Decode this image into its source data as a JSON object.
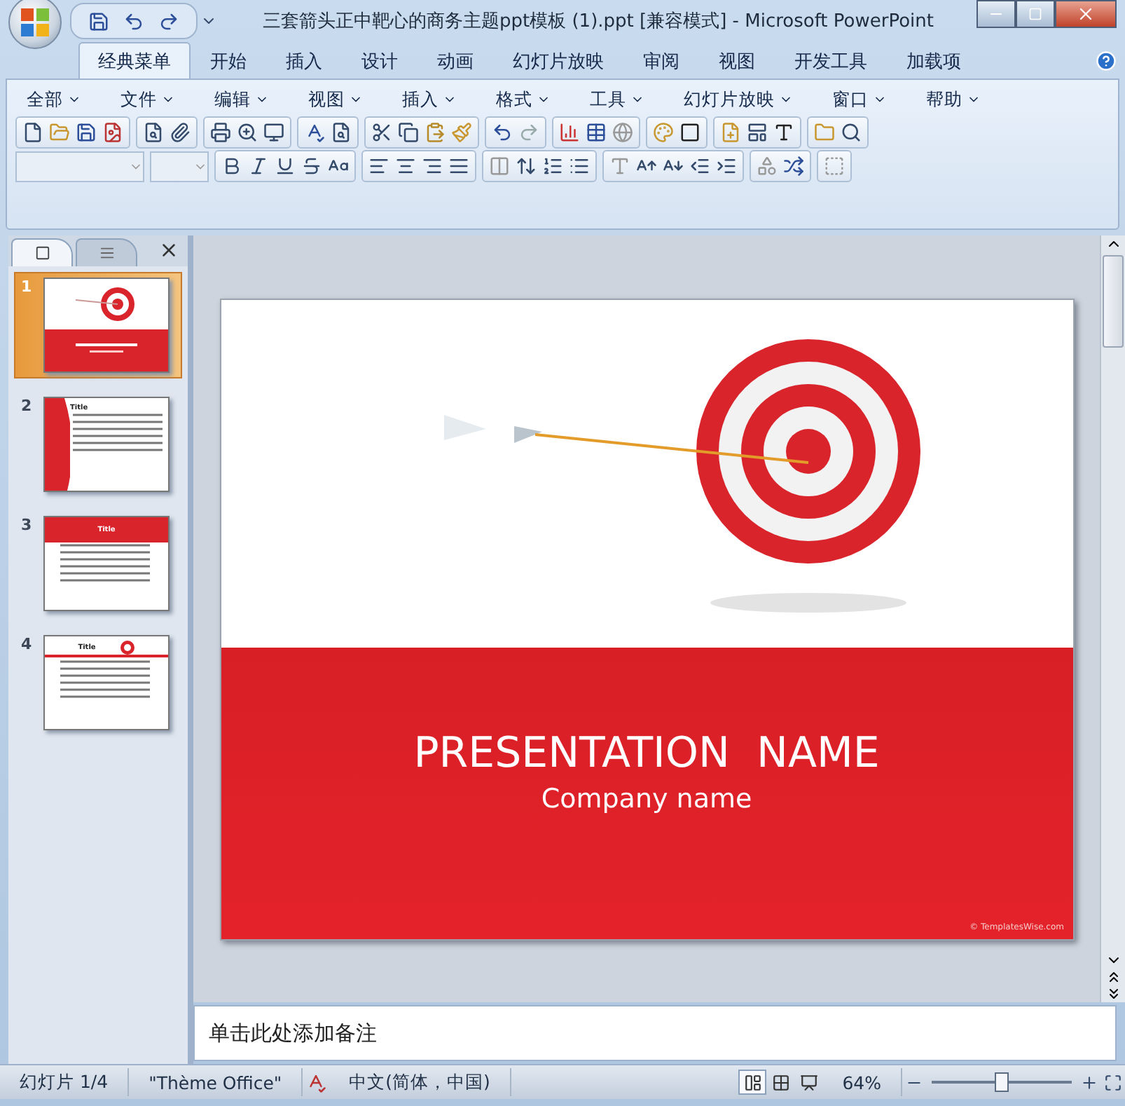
{
  "window": {
    "title": "三套箭头正中靶心的商务主题ppt模板 (1).ppt [兼容模式]  -  Microsoft PowerPoint"
  },
  "ribbon_tabs": [
    {
      "label": "经典菜单",
      "selected": true
    },
    {
      "label": "开始",
      "selected": false
    },
    {
      "label": "插入",
      "selected": false
    },
    {
      "label": "设计",
      "selected": false
    },
    {
      "label": "动画",
      "selected": false
    },
    {
      "label": "幻灯片放映",
      "selected": false
    },
    {
      "label": "审阅",
      "selected": false
    },
    {
      "label": "视图",
      "selected": false
    },
    {
      "label": "开发工具",
      "selected": false
    },
    {
      "label": "加载项",
      "selected": false
    }
  ],
  "menu": [
    "全部",
    "文件",
    "编辑",
    "视图",
    "插入",
    "格式",
    "工具",
    "幻灯片放映",
    "窗口",
    "帮助"
  ],
  "slides_pane": {
    "tabs": [
      {
        "kind": "slides",
        "selected": true
      },
      {
        "kind": "outline",
        "selected": false
      }
    ],
    "thumbnails": [
      {
        "number": "1",
        "kind": "title",
        "selected": true
      },
      {
        "number": "2",
        "kind": "side",
        "title": "Title",
        "selected": false
      },
      {
        "number": "3",
        "kind": "wave",
        "title": "Title",
        "selected": false
      },
      {
        "number": "4",
        "kind": "target",
        "title": "Title",
        "selected": false
      }
    ]
  },
  "slide": {
    "title": "PRESENTATION  NAME",
    "subtitle": "Company name",
    "credit": "© TemplatesWise.com"
  },
  "notes": {
    "placeholder": "单击此处添加备注"
  },
  "status_bar": {
    "slide": "幻灯片 1/4",
    "theme": "\"Thème Office\"",
    "language": "中文(简体，中国)",
    "zoom": "64%",
    "zoom_slider": {
      "level": 0.5
    },
    "views": [
      {
        "kind": "normal",
        "selected": true
      },
      {
        "kind": "sorter",
        "selected": false
      },
      {
        "kind": "show",
        "selected": false
      }
    ]
  }
}
